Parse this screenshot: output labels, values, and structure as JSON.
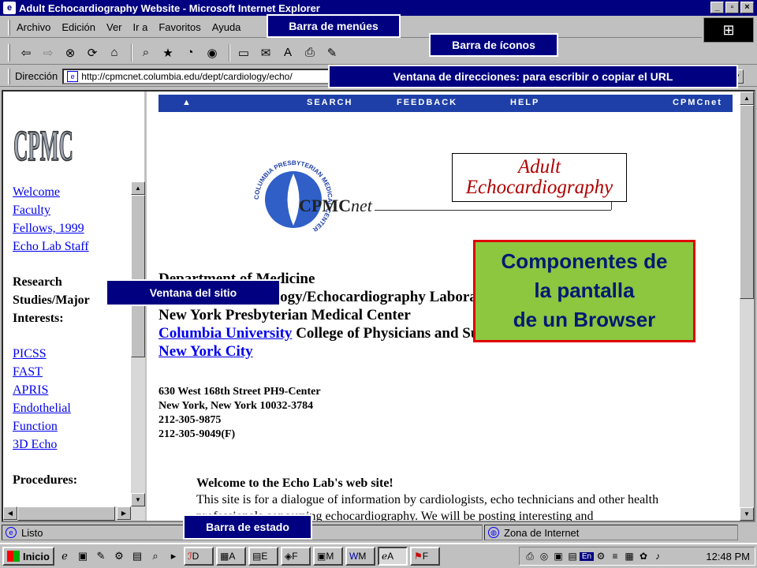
{
  "window": {
    "title": "Adult Echocardiography Website - Microsoft Internet Explorer",
    "controls": [
      "_",
      "▫",
      "×"
    ]
  },
  "menubar": {
    "items": [
      "Archivo",
      "Edición",
      "Ver",
      "Ir a",
      "Favoritos",
      "Ayuda"
    ]
  },
  "toolbar": {
    "icons": [
      "back-icon",
      "forward-icon",
      "stop-icon",
      "refresh-icon",
      "home-icon",
      "search-icon",
      "favorites-icon",
      "history-icon",
      "channels-icon",
      "fullscreen-icon",
      "mail-icon",
      "print-icon",
      "edit-icon"
    ]
  },
  "addressbar": {
    "label": "Dirección",
    "url": "http://cpmcnet.columbia.edu/dept/cardiology/echo/"
  },
  "site": {
    "logo_text": "CPMC",
    "nav_links": [
      "Welcome",
      "Faculty",
      "Fellows, 1999",
      "Echo Lab Staff"
    ],
    "research_heading": [
      "Research",
      "Studies/Major",
      "Interests:"
    ],
    "research_links": [
      "PICSS",
      "FAST",
      "APRIS",
      "Endothelial",
      "Function",
      "3D Echo"
    ],
    "procedures_heading": "Procedures:"
  },
  "main": {
    "bluebar": {
      "up": "▲",
      "search": "SEARCH",
      "feedback": "FEEDBACK",
      "help": "HELP",
      "brand": "CPMCnet"
    },
    "seal_text": "COLUMBIA PRESBYTERIAN MEDICAL CENTER",
    "cpmc_net": "CPMC",
    "cpmc_net_suffix": "net",
    "echo_title_1": "Adult",
    "echo_title_2": "Echocardiography",
    "dept_1": "Department of Medicine",
    "dept_2": "Division of Cardiology/Echocardiography Laboratory",
    "dept_3": "New York Presbyterian Medical Center",
    "dept_4_link": "Columbia University",
    "dept_4_rest": " College of Physicians and Surgeons",
    "dept_5_link": "New York City",
    "address": [
      "630 West 168th Street PH9-Center",
      "New York, New York 10032-3784",
      "212-305-9875",
      "212-305-9049(F)"
    ],
    "welcome_heading": "Welcome to the Echo Lab's web site!",
    "welcome_text": "This site is for a dialogue of information by cardiologists, echo technicians and other health professionals concerning echocardiography. We will be posting interesting and"
  },
  "statusbar": {
    "status": "Listo",
    "zone": "Zona de Internet"
  },
  "taskbar": {
    "start": "Inicio",
    "tasks": [
      "D",
      "A",
      "E",
      "F",
      "M",
      "M",
      "A",
      "F"
    ],
    "tray": [
      "En"
    ],
    "clock": "12:48 PM"
  },
  "callouts": {
    "menubar": "Barra de menúes",
    "iconbar": "Barra de íconos",
    "address": "Ventana de direcciones: para escribir o copiar el URL",
    "site": "Ventana del sitio",
    "status": "Barra de estado",
    "main_line1": "Componentes de",
    "main_line2": "la pantalla",
    "main_line3": "de un Browser"
  },
  "colors": {
    "titlebar": "#000080",
    "callout_bg": "#000080",
    "main_callout_bg": "#8dc63f",
    "main_callout_border": "#e00000",
    "link": "#0000ee",
    "bluebar": "#1e3fa8"
  }
}
